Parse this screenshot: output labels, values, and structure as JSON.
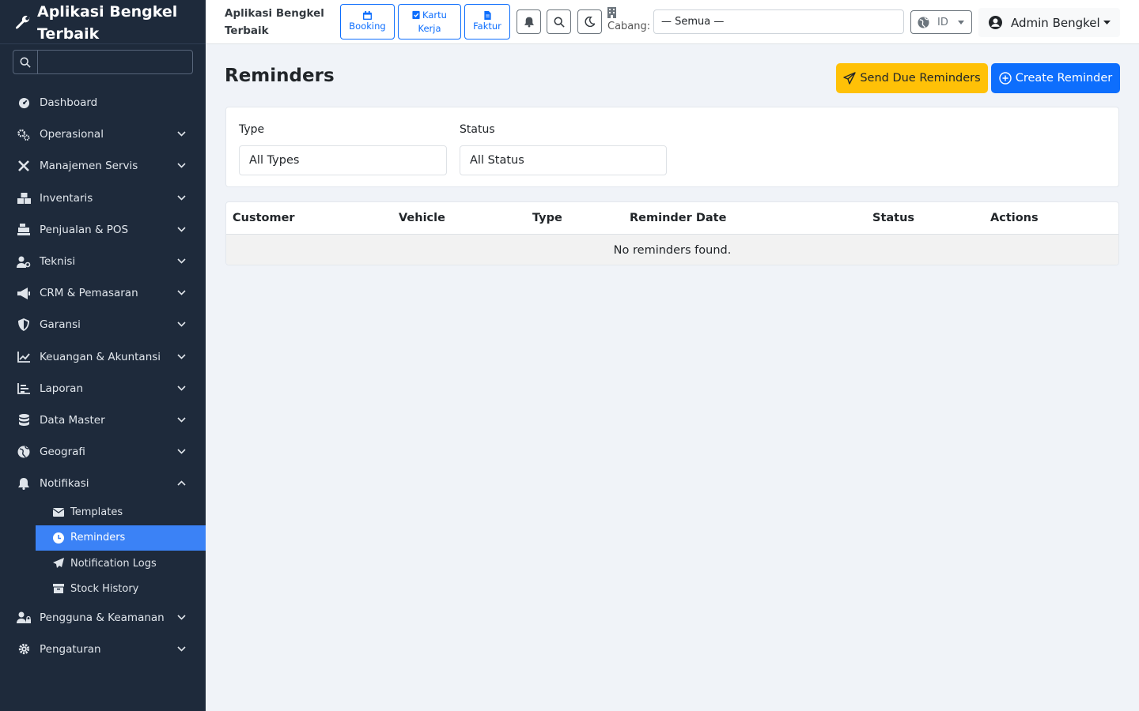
{
  "brand": {
    "name": "Aplikasi Bengkel Terbaik",
    "icon": "wrench-icon"
  },
  "sidebar": {
    "search_placeholder": "",
    "items": [
      {
        "label": "Dashboard",
        "icon": "dashboard-icon"
      },
      {
        "label": "Operasional",
        "icon": "cogs-icon"
      },
      {
        "label": "Manajemen Servis",
        "icon": "tools-icon"
      },
      {
        "label": "Inventaris",
        "icon": "boxes-icon"
      },
      {
        "label": "Penjualan & POS",
        "icon": "cash-register-icon"
      },
      {
        "label": "Teknisi",
        "icon": "user-gear-icon"
      },
      {
        "label": "CRM & Pemasaran",
        "icon": "megaphone-icon"
      },
      {
        "label": "Garansi",
        "icon": "shield-icon"
      },
      {
        "label": "Keuangan & Akuntansi",
        "icon": "chart-line-icon"
      },
      {
        "label": "Laporan",
        "icon": "chart-bar-icon"
      },
      {
        "label": "Data Master",
        "icon": "database-icon"
      },
      {
        "label": "Geografi",
        "icon": "globe-icon"
      },
      {
        "label": "Notifikasi",
        "icon": "bell-icon"
      }
    ],
    "notifikasi_sub": [
      {
        "label": "Templates",
        "icon": "envelope-icon"
      },
      {
        "label": "Reminders",
        "icon": "clock-icon",
        "active": true
      },
      {
        "label": "Notification Logs",
        "icon": "paper-plane-icon"
      },
      {
        "label": "Stock History",
        "icon": "archive-icon"
      }
    ],
    "items_after": [
      {
        "label": "Pengguna & Keamanan",
        "icon": "user-lock-icon"
      },
      {
        "label": "Pengaturan",
        "icon": "gear-icon"
      }
    ]
  },
  "topbar": {
    "title": "Aplikasi Bengkel Terbaik",
    "quick": {
      "booking": "Booking",
      "kartu_kerja": "Kartu Kerja",
      "faktur": "Faktur"
    },
    "cabang_label": "Cabang:",
    "branch_value": "— Semua —",
    "language": "ID",
    "user_name": "Admin Bengkel"
  },
  "page": {
    "title": "Reminders",
    "send_due_label": "Send Due Reminders",
    "create_label": "Create Reminder",
    "filters": {
      "type_label": "Type",
      "type_value": "All Types",
      "status_label": "Status",
      "status_value": "All Status"
    },
    "table": {
      "columns": [
        "Customer",
        "Vehicle",
        "Type",
        "Reminder Date",
        "Status",
        "Actions"
      ],
      "empty_text": "No reminders found."
    }
  },
  "colors": {
    "sidebar_bg": "#1e2a3b",
    "active": "#3b82f6",
    "primary": "#0d6efd",
    "warning": "#ffc107"
  }
}
